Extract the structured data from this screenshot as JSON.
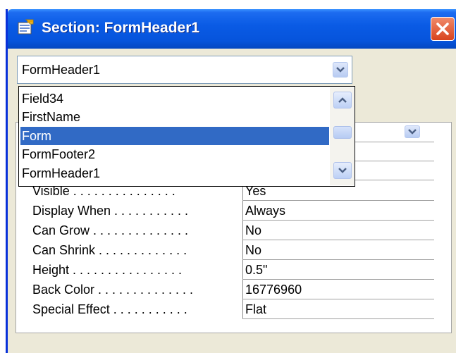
{
  "window": {
    "title": "Section: FormHeader1",
    "colors": {
      "titlebar": "#0a5be5",
      "selection": "#316ac5",
      "close": "#d8431e"
    }
  },
  "object_combo": {
    "value": "FormHeader1"
  },
  "dropdown": {
    "items": [
      "Field34",
      "FirstName",
      "Form",
      "FormFooter2",
      "FormHeader1"
    ],
    "selected": "Form"
  },
  "properties": [
    {
      "label": "Visible . . . . . . . . . . . . . . .",
      "value": "Yes"
    },
    {
      "label": "Display When . . . . . . . . . . .",
      "value": "Always"
    },
    {
      "label": "Can Grow . . . . . . . . . . . . . .",
      "value": "No"
    },
    {
      "label": "Can Shrink . . . . . . . . . . . . .",
      "value": "No"
    },
    {
      "label": "Height . . . . . . . . . . . . . . . .",
      "value": "0.5\""
    },
    {
      "label": "Back Color . . . . . . . . . . . . . .",
      "value": "16776960"
    },
    {
      "label": "Special Effect . . . . . . . . . . .",
      "value": "Flat"
    }
  ],
  "icons": {
    "title": "properties-icon",
    "close": "close-icon"
  }
}
